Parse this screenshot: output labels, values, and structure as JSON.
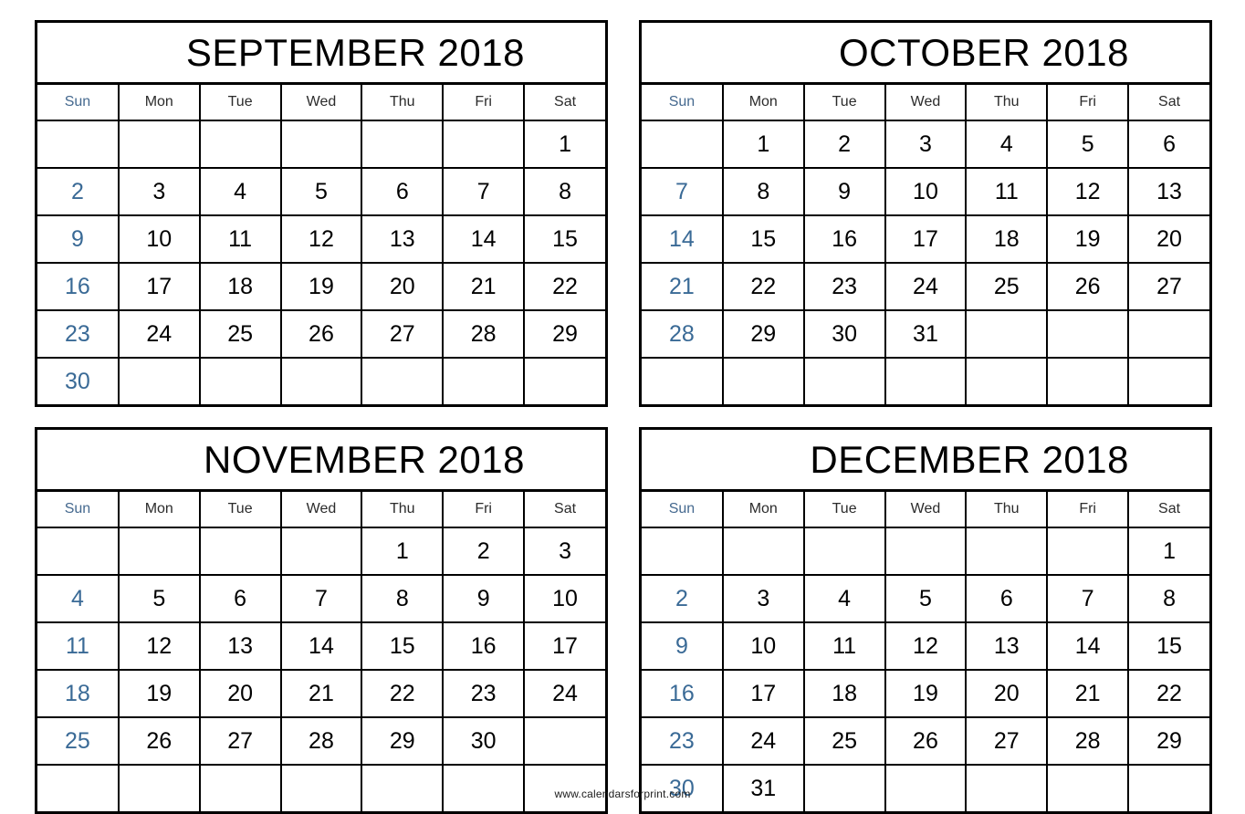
{
  "colors": {
    "sunday_text": "#3a6a96",
    "sunday_header_text": "#45698f",
    "weekday_text": "#000000",
    "border": "#000000",
    "background": "#ffffff"
  },
  "weekday_headers": [
    "Sun",
    "Mon",
    "Tue",
    "Wed",
    "Thu",
    "Fri",
    "Sat"
  ],
  "footer": {
    "text": "www.calendarsforprint.com"
  },
  "months": [
    {
      "title": "SEPTEMBER 2018",
      "name": "September",
      "year": "2018",
      "weeks": [
        [
          "",
          "",
          "",
          "",
          "",
          "",
          "1"
        ],
        [
          "2",
          "3",
          "4",
          "5",
          "6",
          "7",
          "8"
        ],
        [
          "9",
          "10",
          "11",
          "12",
          "13",
          "14",
          "15"
        ],
        [
          "16",
          "17",
          "18",
          "19",
          "20",
          "21",
          "22"
        ],
        [
          "23",
          "24",
          "25",
          "26",
          "27",
          "28",
          "29"
        ],
        [
          "30",
          "",
          "",
          "",
          "",
          "",
          ""
        ]
      ]
    },
    {
      "title": "OCTOBER 2018",
      "name": "October",
      "year": "2018",
      "weeks": [
        [
          "",
          "1",
          "2",
          "3",
          "4",
          "5",
          "6"
        ],
        [
          "7",
          "8",
          "9",
          "10",
          "11",
          "12",
          "13"
        ],
        [
          "14",
          "15",
          "16",
          "17",
          "18",
          "19",
          "20"
        ],
        [
          "21",
          "22",
          "23",
          "24",
          "25",
          "26",
          "27"
        ],
        [
          "28",
          "29",
          "30",
          "31",
          "",
          "",
          ""
        ],
        [
          "",
          "",
          "",
          "",
          "",
          "",
          ""
        ]
      ]
    },
    {
      "title": "NOVEMBER 2018",
      "name": "November",
      "year": "2018",
      "weeks": [
        [
          "",
          "",
          "",
          "",
          "1",
          "2",
          "3"
        ],
        [
          "4",
          "5",
          "6",
          "7",
          "8",
          "9",
          "10"
        ],
        [
          "11",
          "12",
          "13",
          "14",
          "15",
          "16",
          "17"
        ],
        [
          "18",
          "19",
          "20",
          "21",
          "22",
          "23",
          "24"
        ],
        [
          "25",
          "26",
          "27",
          "28",
          "29",
          "30",
          ""
        ],
        [
          "",
          "",
          "",
          "",
          "",
          "",
          ""
        ]
      ]
    },
    {
      "title": "DECEMBER 2018",
      "name": "December",
      "year": "2018",
      "weeks": [
        [
          "",
          "",
          "",
          "",
          "",
          "",
          "1"
        ],
        [
          "2",
          "3",
          "4",
          "5",
          "6",
          "7",
          "8"
        ],
        [
          "9",
          "10",
          "11",
          "12",
          "13",
          "14",
          "15"
        ],
        [
          "16",
          "17",
          "18",
          "19",
          "20",
          "21",
          "22"
        ],
        [
          "23",
          "24",
          "25",
          "26",
          "27",
          "28",
          "29"
        ],
        [
          "30",
          "31",
          "",
          "",
          "",
          "",
          ""
        ]
      ]
    }
  ]
}
